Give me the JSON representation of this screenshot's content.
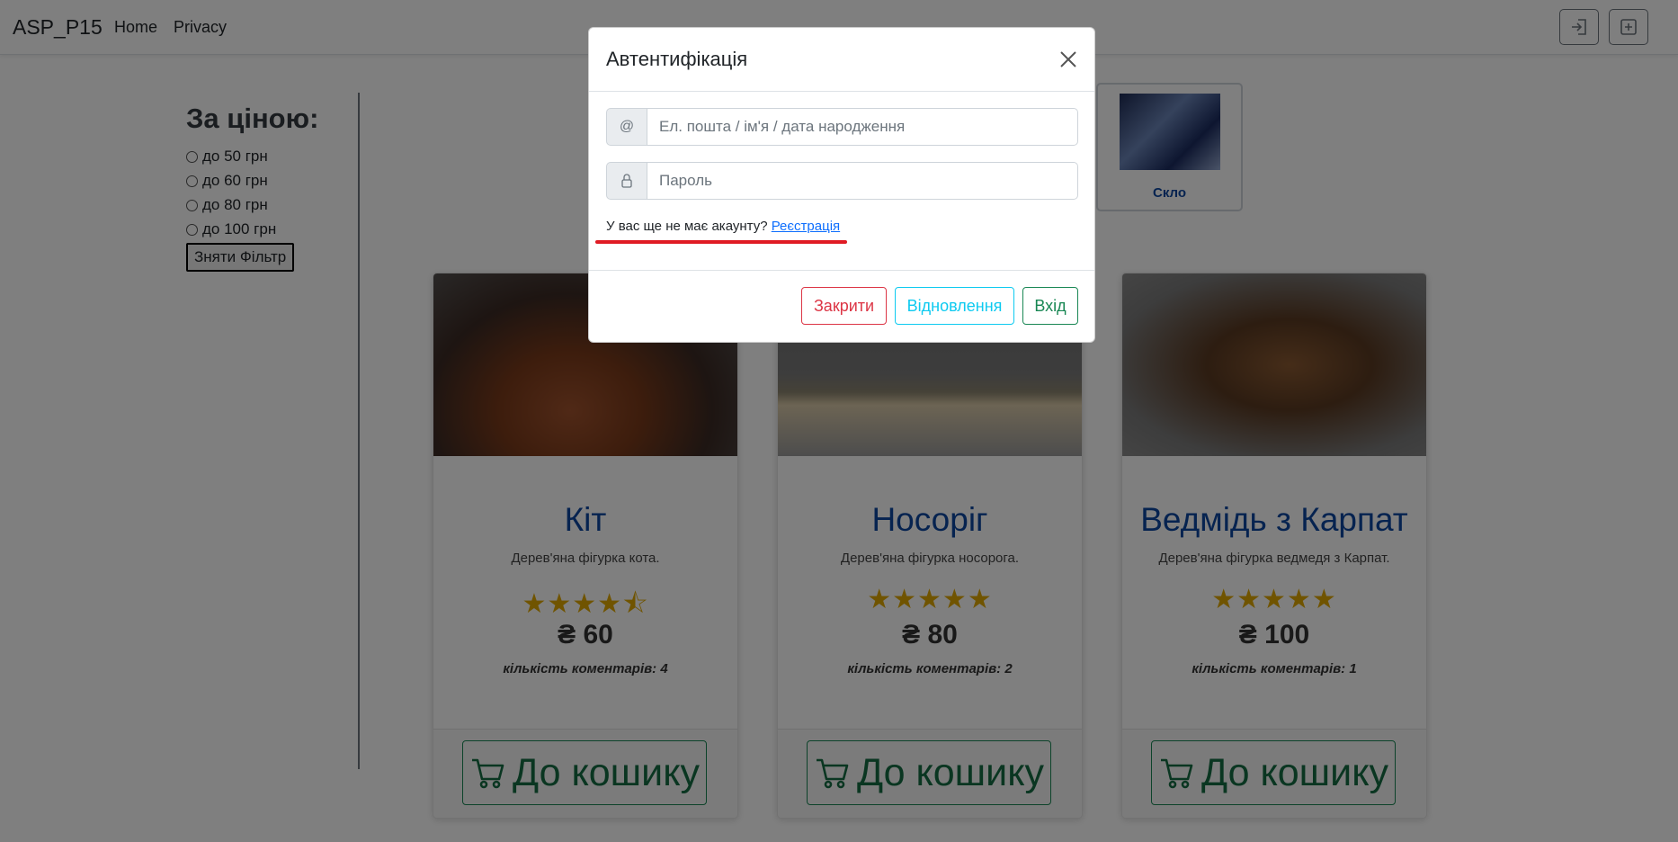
{
  "navbar": {
    "brand": "ASP_P15",
    "links": [
      "Home",
      "Privacy"
    ],
    "icons": [
      "sign-in-icon",
      "plus-square-icon"
    ]
  },
  "filter": {
    "title": "За ціною:",
    "options": [
      "до 50 грн",
      "до 60 грн",
      "до 80 грн",
      "до 100 грн"
    ],
    "clear_label": "Зняти Фільтр"
  },
  "category": {
    "label": "Скло"
  },
  "products": [
    {
      "title": "Кіт",
      "description": "Дерев'яна фігурка кота.",
      "rating": 4.5,
      "stars": "★★★★⯪",
      "price": "₴ 60",
      "comments": "кількість коментарів: 4",
      "cart_label": "До кошику"
    },
    {
      "title": "Носоріг",
      "description": "Дерев'яна фігурка носорога.",
      "rating": 5,
      "stars": "★★★★★",
      "price": "₴ 80",
      "comments": "кількість коментарів: 2",
      "cart_label": "До кошику"
    },
    {
      "title": "Ведмідь з Карпат",
      "description": "Дерев'яна фігурка ведмедя з Карпат.",
      "rating": 5,
      "stars": "★★★★★",
      "price": "₴ 100",
      "comments": "кількість коментарів: 1",
      "cart_label": "До кошику"
    }
  ],
  "modal": {
    "title": "Автентифікація",
    "login_prefix": "@",
    "login_placeholder": "Ел. пошта / ім'я / дата народження",
    "password_placeholder": "Пароль",
    "no_account_text": "У вас ще не має акаунту?",
    "register_link": "Реєстрація",
    "buttons": {
      "close": "Закрити",
      "restore": "Відновлення",
      "login": "Вхід"
    }
  },
  "colors": {
    "accent_blue": "#0d47a1",
    "success": "#198754",
    "danger": "#dc3545",
    "info": "#0dcaf0",
    "star": "#e0a800",
    "annotation_red": "#e01b24"
  }
}
